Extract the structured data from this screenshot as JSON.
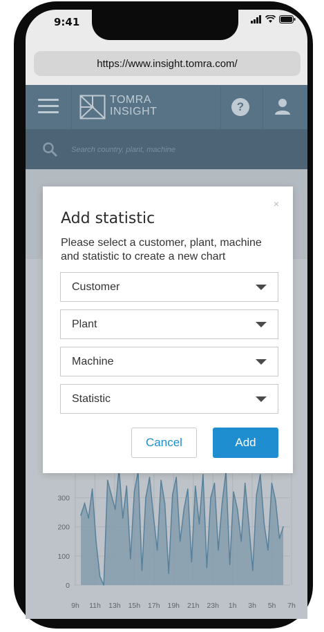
{
  "status_bar": {
    "time": "9:41"
  },
  "browser": {
    "url": "https://www.insight.tomra.com/"
  },
  "app": {
    "logo_line1": "TOMRA",
    "logo_line2": "INSIGHT",
    "help_label": "?"
  },
  "search": {
    "placeholder": "Search country, plant, machine"
  },
  "modal": {
    "title": "Add statistic",
    "description": "Please select a customer, plant, machine and statistic to create a new chart",
    "close_label": "×",
    "selects": [
      {
        "value": "Customer"
      },
      {
        "value": "Plant"
      },
      {
        "value": "Machine"
      },
      {
        "value": "Statistic"
      }
    ],
    "cancel_label": "Cancel",
    "add_label": "Add"
  },
  "colors": {
    "app_bar": "#4e6e85",
    "search_bar": "#3e5a6f",
    "accent": "#1f8ed0",
    "chart_fill": "#8fb3c9",
    "chart_line": "#3f7ea8"
  },
  "chart_data": {
    "type": "area",
    "categories": [
      "9h",
      "11h",
      "13h",
      "15h",
      "17h",
      "19h",
      "21h",
      "23h",
      "1h",
      "3h",
      "5h",
      "7h"
    ],
    "yticks": [
      0,
      100,
      200,
      300
    ],
    "ylim": [
      0,
      420
    ],
    "values": [
      240,
      280,
      230,
      330,
      150,
      30,
      0,
      360,
      310,
      260,
      400,
      230,
      340,
      90,
      320,
      390,
      50,
      300,
      370,
      240,
      120,
      360,
      280,
      40,
      310,
      370,
      150,
      260,
      330,
      80,
      340,
      210,
      380,
      60,
      300,
      350,
      120,
      280,
      390,
      70,
      320,
      260,
      150,
      350,
      210,
      50,
      310,
      380,
      210,
      120,
      350,
      290,
      160,
      200
    ]
  }
}
